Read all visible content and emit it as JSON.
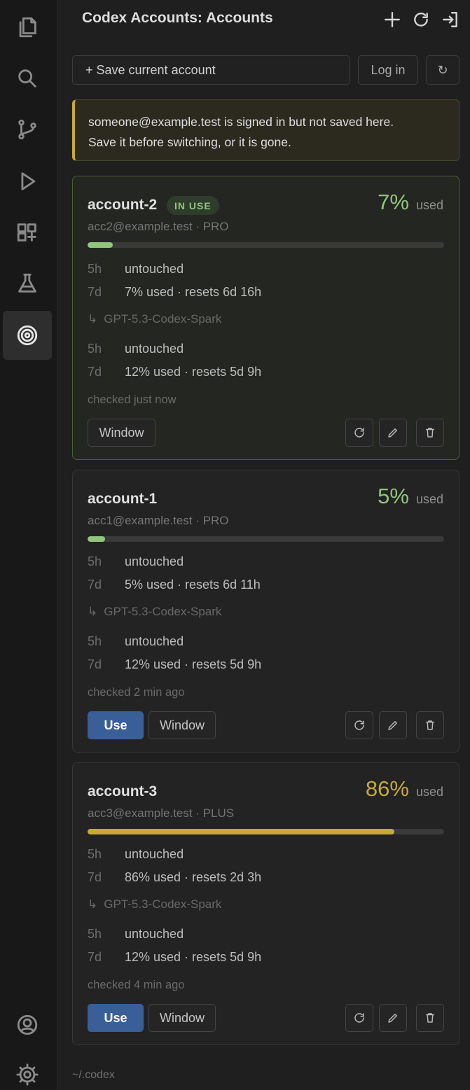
{
  "activity_bar": {
    "items": [
      {
        "name": "explorer-icon"
      },
      {
        "name": "search-icon"
      },
      {
        "name": "source-control-icon"
      },
      {
        "name": "run-debug-icon"
      },
      {
        "name": "extensions-icon"
      },
      {
        "name": "testing-icon"
      },
      {
        "name": "codex-accounts-icon",
        "active": true
      }
    ],
    "bottom": [
      {
        "name": "account-icon"
      },
      {
        "name": "settings-gear-icon"
      }
    ]
  },
  "header": {
    "title": "Codex Accounts: Accounts",
    "actions": [
      "add-icon",
      "refresh-icon",
      "sign-in-icon"
    ]
  },
  "toolbar": {
    "save_label": "+ Save current account",
    "login_label": "Log in",
    "refresh_glyph": "↻"
  },
  "warning": {
    "line1": "someone@example.test is signed in but not saved here.",
    "line2": "Save it before switching, or it is gone."
  },
  "colors": {
    "accent_green": "#93c47d",
    "accent_yellow": "#c6a93b",
    "use_button": "#3a5f98"
  },
  "accounts": [
    {
      "name": "account-2",
      "badge": "IN USE",
      "pct": "7%",
      "pct_label": "used",
      "usage_fraction": 0.07,
      "email_plan": "acc2@example.test · PRO",
      "limits": [
        {
          "k": "5h",
          "v": "untouched"
        },
        {
          "k": "7d",
          "v": "7% used · resets 6d 16h"
        }
      ],
      "model": {
        "arrow": "↳",
        "name": "GPT-5.3-Codex-Spark"
      },
      "model_limits": [
        {
          "k": "5h",
          "v": "untouched"
        },
        {
          "k": "7d",
          "v": "12% used · resets 5d 9h"
        }
      ],
      "checked": "checked just now",
      "window_label": "Window"
    },
    {
      "name": "account-1",
      "pct": "5%",
      "pct_label": "used",
      "usage_fraction": 0.05,
      "email_plan": "acc1@example.test · PRO",
      "limits": [
        {
          "k": "5h",
          "v": "untouched"
        },
        {
          "k": "7d",
          "v": "5% used · resets 6d 11h"
        }
      ],
      "model": {
        "arrow": "↳",
        "name": "GPT-5.3-Codex-Spark"
      },
      "model_limits": [
        {
          "k": "5h",
          "v": "untouched"
        },
        {
          "k": "7d",
          "v": "12% used · resets 5d 9h"
        }
      ],
      "checked": "checked 2 min ago",
      "use_label": "Use",
      "window_label": "Window"
    },
    {
      "name": "account-3",
      "pct": "86%",
      "pct_label": "used",
      "usage_fraction": 0.86,
      "email_plan": "acc3@example.test · PLUS",
      "limits": [
        {
          "k": "5h",
          "v": "untouched"
        },
        {
          "k": "7d",
          "v": "86% used · resets 2d 3h"
        }
      ],
      "model": {
        "arrow": "↳",
        "name": "GPT-5.3-Codex-Spark"
      },
      "model_limits": [
        {
          "k": "5h",
          "v": "untouched"
        },
        {
          "k": "7d",
          "v": "12% used · resets 5d 9h"
        }
      ],
      "checked": "checked 4 min ago",
      "use_label": "Use",
      "window_label": "Window"
    }
  ],
  "footer": {
    "path": "~/.codex"
  }
}
